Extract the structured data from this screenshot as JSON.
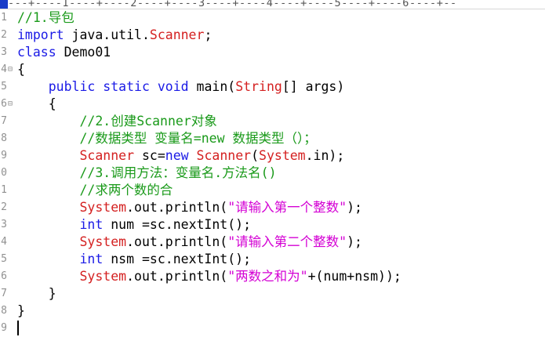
{
  "ruler": {
    "text": "---+----1----+----2----+----3----+----4----+----5----+----6----+--"
  },
  "gutter": {
    "line_numbers": [
      "1",
      "2",
      "3",
      "4",
      "5",
      "6",
      "7",
      "8",
      "9",
      "0",
      "1",
      "2",
      "3",
      "4",
      "5",
      "6",
      "7",
      "8",
      "9"
    ],
    "fold_markers": {
      "3": "⊟",
      "5": "⊟"
    }
  },
  "code_lines": [
    [
      {
        "t": "//1.导包",
        "c": "cmt"
      }
    ],
    [
      {
        "t": "import",
        "c": "kw"
      },
      {
        "t": " java.util.",
        "c": "plain"
      },
      {
        "t": "Scanner",
        "c": "cls"
      },
      {
        "t": ";",
        "c": "plain"
      }
    ],
    [
      {
        "t": "class",
        "c": "kw"
      },
      {
        "t": " Demo01",
        "c": "plain"
      }
    ],
    [
      {
        "t": "{",
        "c": "plain"
      }
    ],
    [
      {
        "t": "    ",
        "c": "plain"
      },
      {
        "t": "public",
        "c": "kw"
      },
      {
        "t": " ",
        "c": "plain"
      },
      {
        "t": "static",
        "c": "kw"
      },
      {
        "t": " ",
        "c": "plain"
      },
      {
        "t": "void",
        "c": "kw"
      },
      {
        "t": " main(",
        "c": "plain"
      },
      {
        "t": "String",
        "c": "cls"
      },
      {
        "t": "[] args)",
        "c": "plain"
      }
    ],
    [
      {
        "t": "    {",
        "c": "plain"
      }
    ],
    [
      {
        "t": "        ",
        "c": "plain"
      },
      {
        "t": "//2.创建Scanner对象",
        "c": "cmt"
      }
    ],
    [
      {
        "t": "        ",
        "c": "plain"
      },
      {
        "t": "//数据类型 变量名=new 数据类型（）；",
        "c": "cmt"
      }
    ],
    [
      {
        "t": "        ",
        "c": "plain"
      },
      {
        "t": "Scanner",
        "c": "cls"
      },
      {
        "t": " sc=",
        "c": "plain"
      },
      {
        "t": "new",
        "c": "kw"
      },
      {
        "t": " ",
        "c": "plain"
      },
      {
        "t": "Scanner",
        "c": "cls"
      },
      {
        "t": "(",
        "c": "plain"
      },
      {
        "t": "System",
        "c": "cls"
      },
      {
        "t": ".in);",
        "c": "plain"
      }
    ],
    [
      {
        "t": "        ",
        "c": "plain"
      },
      {
        "t": "//3.调用方法：变量名.方法名()",
        "c": "cmt"
      }
    ],
    [
      {
        "t": "        ",
        "c": "plain"
      },
      {
        "t": "//求两个数的合",
        "c": "cmt"
      }
    ],
    [
      {
        "t": "        ",
        "c": "plain"
      },
      {
        "t": "System",
        "c": "cls"
      },
      {
        "t": ".out.println(",
        "c": "plain"
      },
      {
        "t": "\"请输入第一个整数\"",
        "c": "str"
      },
      {
        "t": ");",
        "c": "plain"
      }
    ],
    [
      {
        "t": "        ",
        "c": "plain"
      },
      {
        "t": "int",
        "c": "kw"
      },
      {
        "t": " num =sc.nextInt();",
        "c": "plain"
      }
    ],
    [
      {
        "t": "        ",
        "c": "plain"
      },
      {
        "t": "System",
        "c": "cls"
      },
      {
        "t": ".out.println(",
        "c": "plain"
      },
      {
        "t": "\"请输入第二个整数\"",
        "c": "str"
      },
      {
        "t": ");",
        "c": "plain"
      }
    ],
    [
      {
        "t": "        ",
        "c": "plain"
      },
      {
        "t": "int",
        "c": "kw"
      },
      {
        "t": " nsm =sc.nextInt();",
        "c": "plain"
      }
    ],
    [
      {
        "t": "        ",
        "c": "plain"
      },
      {
        "t": "System",
        "c": "cls"
      },
      {
        "t": ".out.println(",
        "c": "plain"
      },
      {
        "t": "\"两数之和为\"",
        "c": "str"
      },
      {
        "t": "+(num+nsm));",
        "c": "plain"
      }
    ],
    [
      {
        "t": "    }",
        "c": "plain"
      }
    ],
    [
      {
        "t": "}",
        "c": "plain"
      }
    ],
    []
  ],
  "colors": {
    "keyword": "#1a1ae6",
    "class": "#d42020",
    "string": "#d400d4",
    "comment": "#1a9a1a"
  }
}
